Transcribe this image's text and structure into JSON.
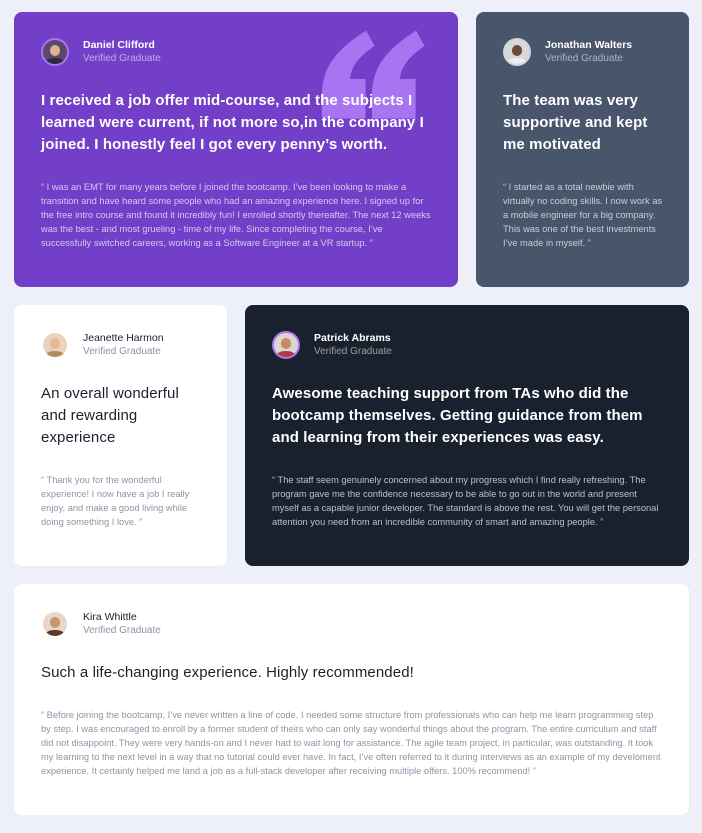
{
  "colors": {
    "page_bg": "#edf0f8",
    "purple": "#733fc8",
    "slate": "#48556a",
    "dark": "#19212e",
    "white": "#ffffff",
    "quote_mark": "#a775f1"
  },
  "testimonials": [
    {
      "name": "Daniel Clifford",
      "role": "Verified Graduate",
      "headline": "I received a job offer mid-course, and the subjects I learned were current, if not more so,in the company I joined. I honestly feel I got every penny’s worth.",
      "body": "“ I was an EMT for many years before I joined the bootcamp. I’ve been looking to make a transition and have heard some people who had an amazing experience here. I signed up for the free intro course and found it incredibly fun! I enrolled shortly thereafter. The next 12 weeks was the best - and most grueling - time of my life. Since completing the course, I’ve successfully switched careers, working as a Software Engineer at a VR startup. ”",
      "avatar_icon": "person-avatar-icon"
    },
    {
      "name": "Jonathan Walters",
      "role": "Verified Graduate",
      "headline": "The team was very supportive and kept me motivated",
      "body": "“ I started as a total newbie with virtually no coding skills. I now work as a mobile engineer for a big company. This was one of the best investments I’ve made in myself. ”",
      "avatar_icon": "person-avatar-icon"
    },
    {
      "name": "Jeanette Harmon",
      "role": "Verified Graduate",
      "headline": "An overall wonderful and rewarding experience",
      "body": "“ Thank you for the wonderful experience! I now have a job I really enjoy, and make a good living while doing something I love. ”",
      "avatar_icon": "person-avatar-icon"
    },
    {
      "name": "Patrick Abrams",
      "role": "Verified Graduate",
      "headline": "Awesome teaching support from TAs who did the bootcamp themselves. Getting guidance from them and learning from their experiences was easy.",
      "body": "“ The staff seem genuinely concerned about my progress which I find really refreshing. The program gave me the confidence necessary to be able to go out in the world and present myself as a capable junior developer. The standard is above the rest. You will get the personal attention you need from an incredible community of smart and amazing people. ”",
      "avatar_icon": "person-avatar-icon"
    },
    {
      "name": "Kira Whittle",
      "role": "Verified Graduate",
      "headline": "Such a life-changing experience. Highly recommended!",
      "body": "“ Before joining the bootcamp, I’ve never written a line of code. I needed some structure from professionals who can help me learn programming step by step. I was encouraged to enroll by a former student of theirs who can only say wonderful things about the program. The entire curriculum and staff did not disappoint. They were very hands-on and I never had to wait long for assistance. The agile team project, in particular, was outstanding. It took my learning to the next level in a way that no tutorial could ever have. In fact, I’ve often referred to it during interviews as an example of my develoment experience. It certainly helped me land a job as a full-stack developer after receiving multiple offers. 100% recommend! ”",
      "avatar_icon": "person-avatar-icon"
    }
  ],
  "decor": {
    "quote_icon": "quotation-mark-icon"
  }
}
